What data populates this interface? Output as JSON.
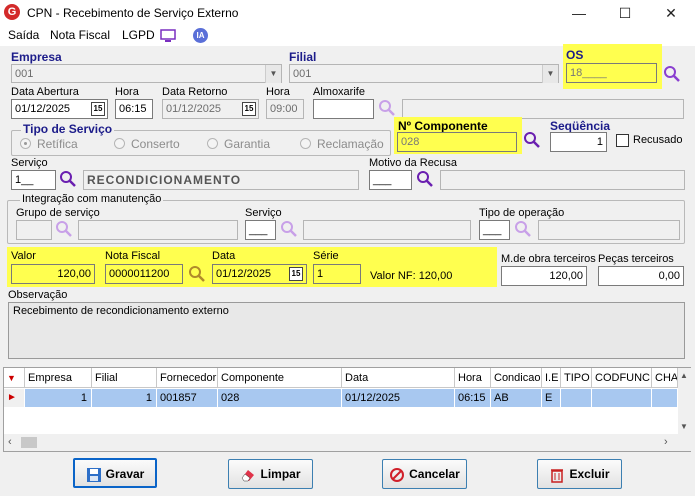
{
  "window": {
    "title": "CPN - Recebimento de Serviço Externo",
    "minimize": "—",
    "maximize": "☐",
    "close": "✕"
  },
  "menu": {
    "items": [
      "Saída",
      "Nota Fiscal",
      "LGPD"
    ],
    "ia": "IA"
  },
  "empresa": {
    "label": "Empresa",
    "value": "001"
  },
  "filial": {
    "label": "Filial",
    "value": "001"
  },
  "os": {
    "label": "OS",
    "value": "18____"
  },
  "data_abertura": {
    "label": "Data Abertura",
    "value": "01/12/2025"
  },
  "hora": {
    "label": "Hora",
    "value": "06:15"
  },
  "data_retorno": {
    "label": "Data Retorno",
    "value": "01/12/2025"
  },
  "hora2": {
    "label": "Hora",
    "value": "09:00"
  },
  "almoxarife": {
    "label": "Almoxarife",
    "value": "",
    "desc": ""
  },
  "tipo_servico": {
    "label": "Tipo de Serviço",
    "options": [
      "Retífica",
      "Conserto",
      "Garantia",
      "Reclamação"
    ]
  },
  "componente": {
    "label": "Nº  Componente",
    "value": "028"
  },
  "sequencia": {
    "label": "Seqüência",
    "value": "1"
  },
  "recusado": {
    "label": "Recusado"
  },
  "servico": {
    "label": "Serviço",
    "value": "1__",
    "desc": "RECONDICIONAMENTO"
  },
  "motivo_recusa": {
    "label": "Motivo da Recusa",
    "value": "___"
  },
  "integracao": {
    "label": "Integração com manutenção",
    "grupo_label": "Grupo de serviço",
    "servico_label": "Serviço",
    "servico_value": "___",
    "tipo_label": "Tipo de operação",
    "tipo_value": "___"
  },
  "valor": {
    "label": "Valor",
    "value": "120,00"
  },
  "nota_fiscal": {
    "label": "Nota Fiscal",
    "value": "0000011200"
  },
  "data_nf": {
    "label": "Data",
    "value": "01/12/2025"
  },
  "serie": {
    "label": "Série",
    "value": "1"
  },
  "valor_nf": {
    "text": "Valor NF: 120,00"
  },
  "mo_terceiros": {
    "label": "M.de obra terceiros",
    "value": "120,00"
  },
  "pecas_terceiros": {
    "label": "Peças terceiros",
    "value": "0,00"
  },
  "observacao": {
    "label": "Observação",
    "value": "Recebimento de recondicionamento externo"
  },
  "grid": {
    "columns": [
      "Empresa",
      "Filial",
      "Fornecedor",
      "Componente",
      "Data",
      "Hora",
      "Condicao",
      "I.E",
      "TIPO",
      "CODFUNC",
      "CHA"
    ],
    "rows": [
      [
        "1",
        "1",
        "001857",
        "028",
        "01/12/2025",
        "06:15",
        "AB",
        "E",
        "",
        "",
        ""
      ]
    ]
  },
  "buttons": {
    "gravar": "Gravar",
    "limpar": "Limpar",
    "cancelar": "Cancelar",
    "excluir": "Excluir"
  },
  "colors": {
    "accent": "#1c1c8a",
    "highlight": "#ffff4f",
    "selected_row": "#a8c8f0"
  }
}
